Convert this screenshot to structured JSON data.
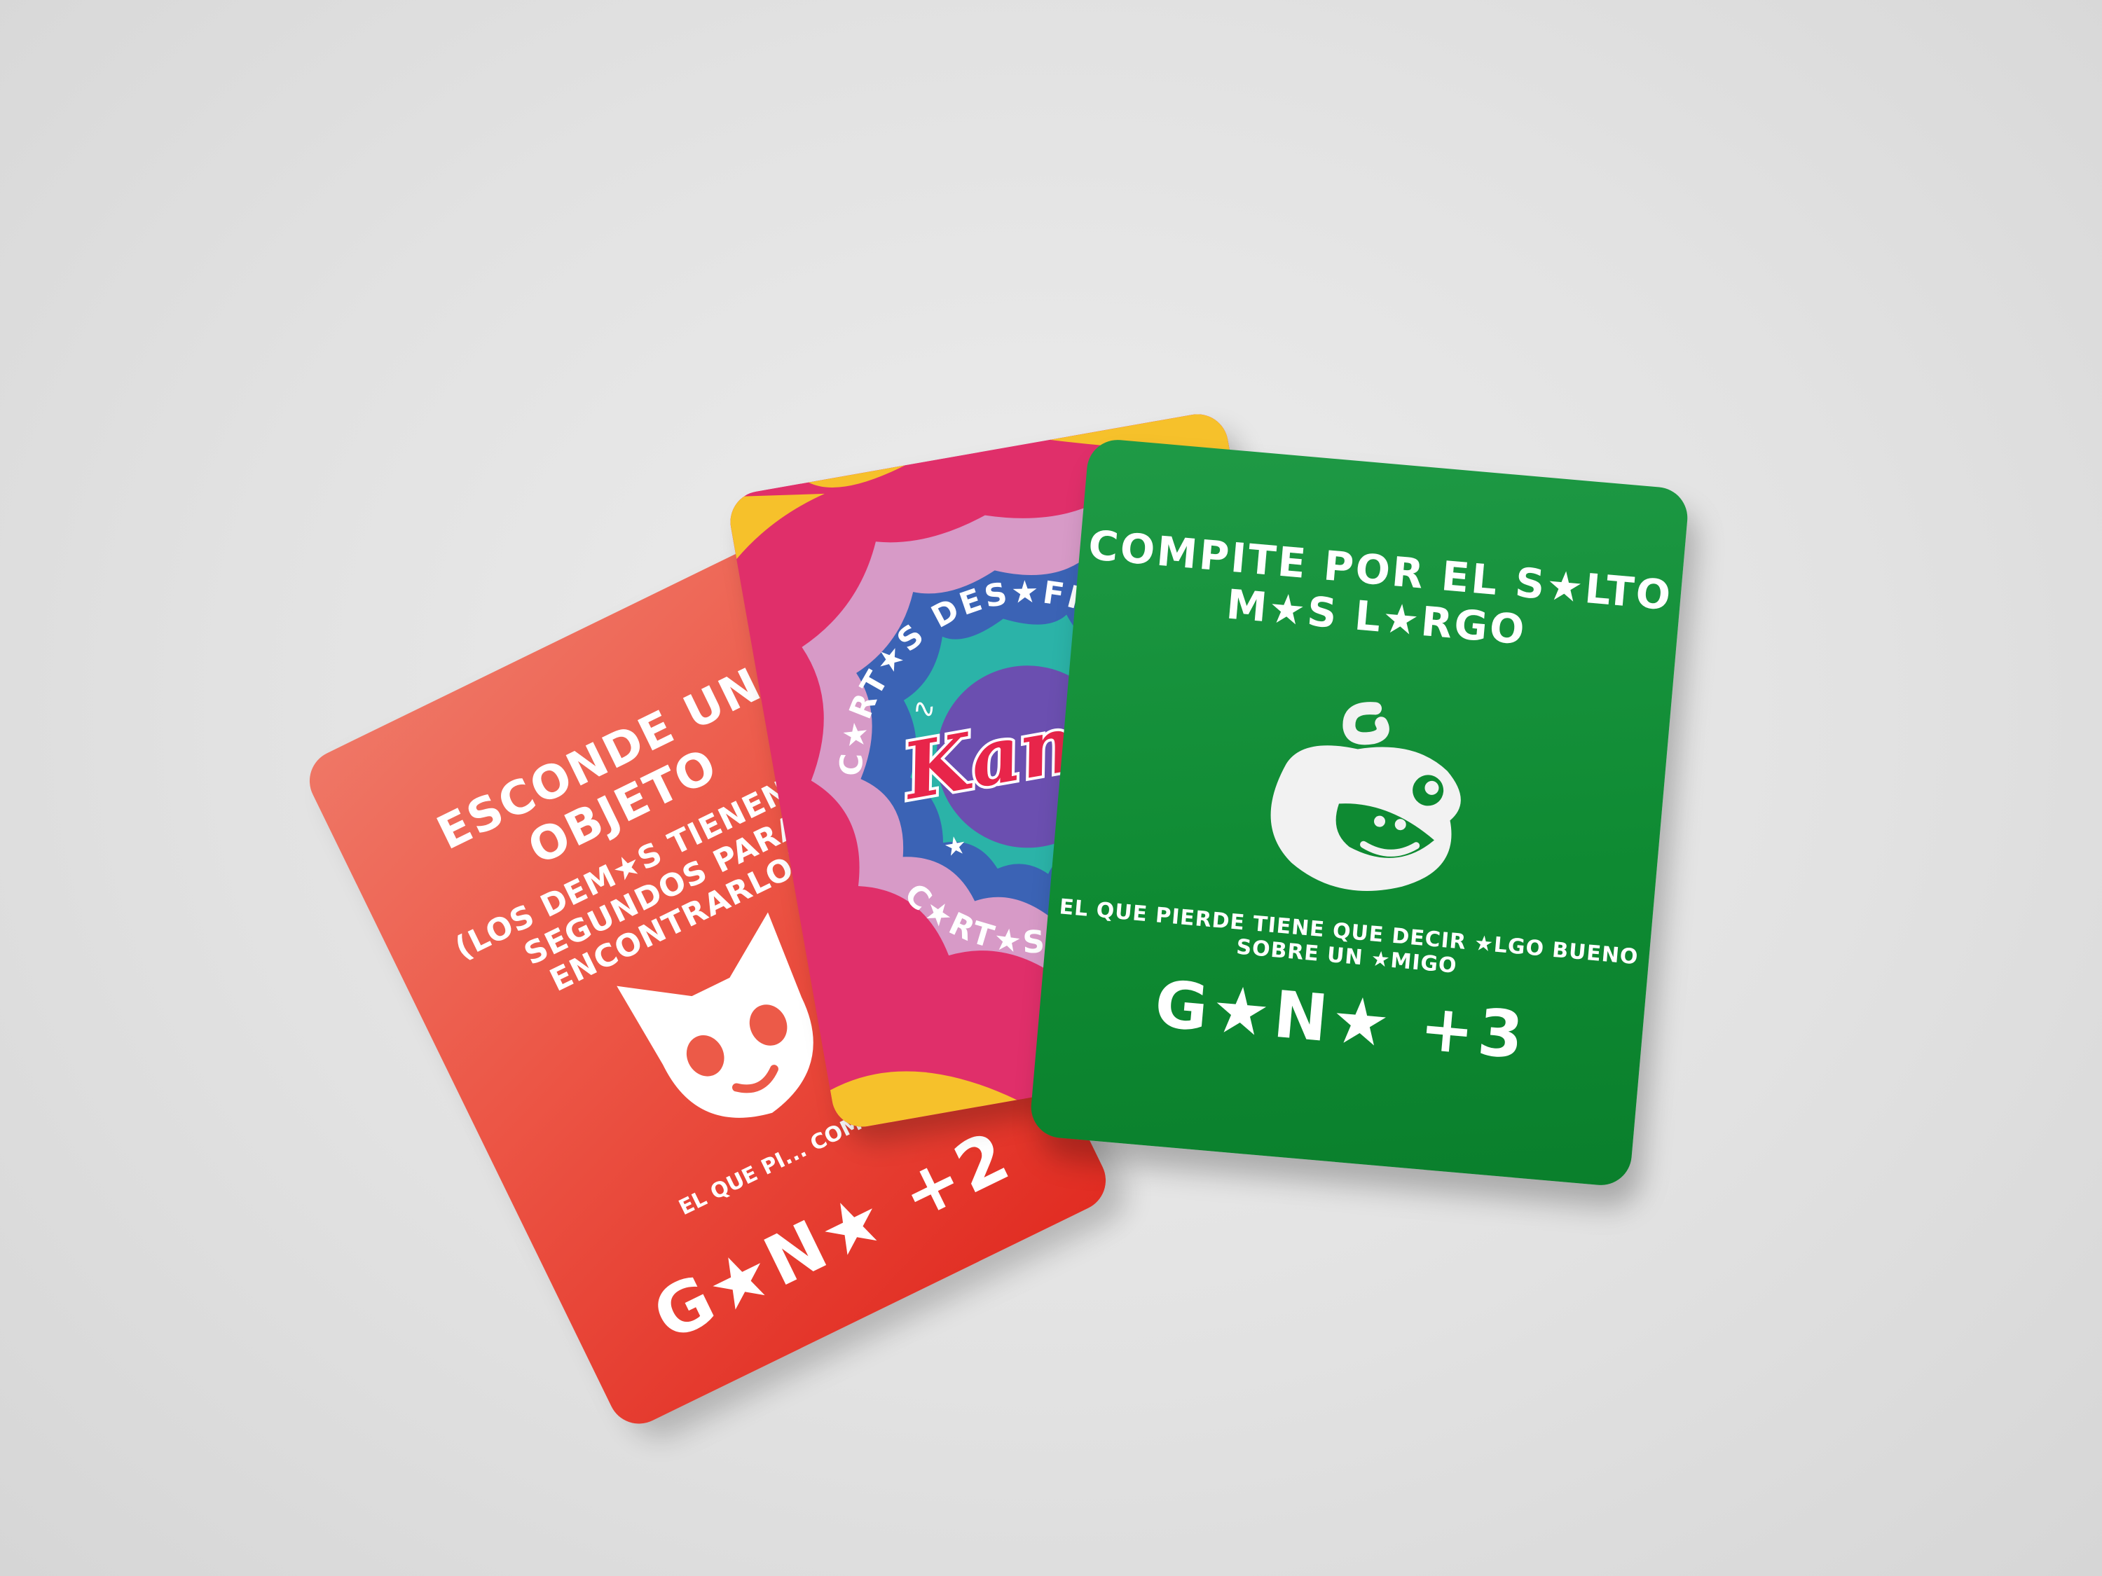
{
  "scene": {
    "background_color": "#e3e3e3",
    "cards": {
      "red": {
        "title": "ESCONDE UN OBJETO",
        "subtitle": "(LOS DEM★S TIENEN 60 SEGUNDOS PARA ENCONTRARLO)",
        "footer": "EL QUE PI... COMO ...",
        "score": "G★N★ +2",
        "color": "#e8412f",
        "mascot": "fox-mascot-icon"
      },
      "back": {
        "ring_text_top": "C★RT★S DES★FIO DE L★",
        "ring_text_bottom": "C★RT★S DES★FIO",
        "logo": "Kamë",
        "colors": [
          "#e02f6a",
          "#f6c12b",
          "#d79ac7",
          "#3b63b5",
          "#2bb3a8",
          "#6b4fb0"
        ],
        "mascot": "hat-mascot-icon"
      },
      "green": {
        "title": "COMPITE POR EL S★LTO M★S L★RGO",
        "footer": "EL QUE PIERDE TIENE QUE DECIR ★LGO BUENO SOBRE UN ★MIGO",
        "score": "G★N★ +3",
        "color": "#0e8a32",
        "mascot": "frog-mascot-icon"
      }
    }
  }
}
